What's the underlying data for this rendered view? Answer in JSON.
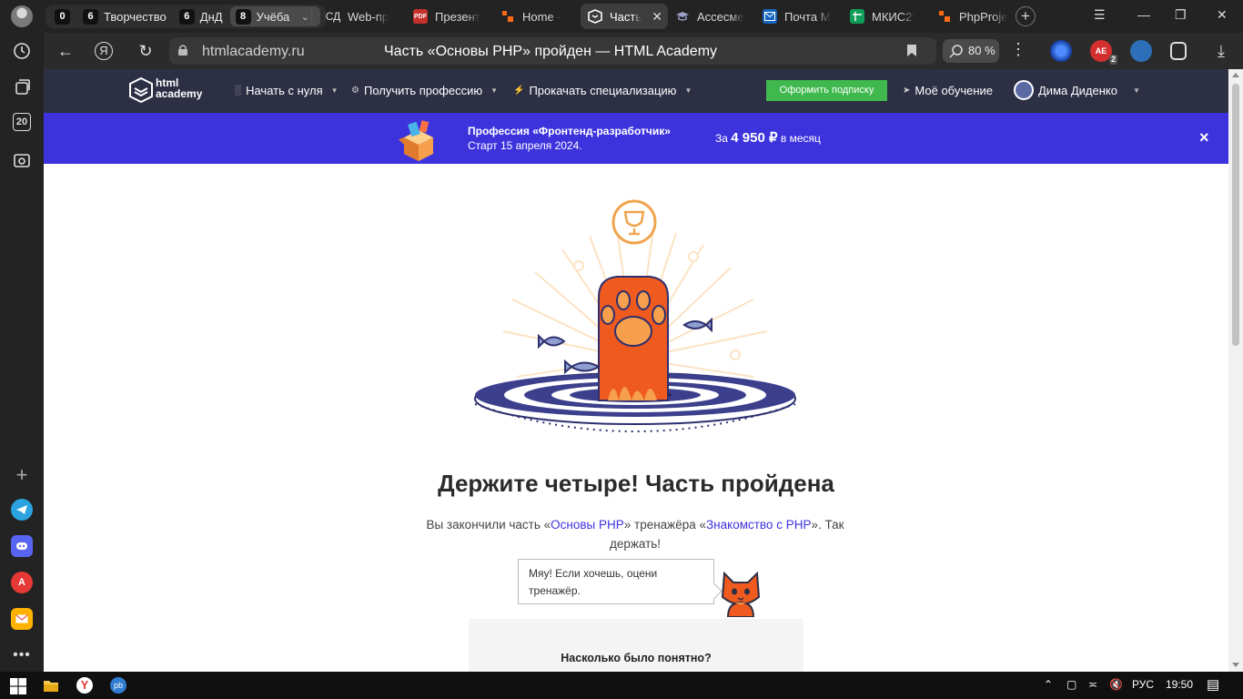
{
  "browser": {
    "tab_groups": [
      {
        "count": "0",
        "label": ""
      },
      {
        "count": "6",
        "label": "Творчество"
      },
      {
        "count": "6",
        "label": "ДнД"
      },
      {
        "count": "8",
        "label": "Учёба"
      }
    ],
    "tabs": [
      {
        "label": "Web-пр",
        "icon": "СД"
      },
      {
        "label": "Презент",
        "icon": "PDF"
      },
      {
        "label": "Home -",
        "icon": "trello-icon"
      },
      {
        "label": "Часть",
        "icon": "htmlacademy-icon",
        "active": true
      },
      {
        "label": "Ассесме",
        "icon": "cap-icon"
      },
      {
        "label": "Почта М",
        "icon": "mail-icon"
      },
      {
        "label": "МКИС2'",
        "icon": "sheets-icon"
      },
      {
        "label": "PhpProje",
        "icon": "trello-icon"
      }
    ],
    "sidebar_counter": "20",
    "address": {
      "domain": "htmlacademy.ru",
      "title": "Часть «Основы PHP» пройден — HTML Academy",
      "zoom": "80 %"
    },
    "extensions": [
      {
        "name": "vpn-icon"
      },
      {
        "name": "adblock-icon",
        "badge": "2"
      },
      {
        "name": "translate-icon"
      },
      {
        "name": "collections-icon"
      },
      {
        "name": "download-icon"
      }
    ]
  },
  "site": {
    "logo": [
      "html",
      "academy"
    ],
    "menu": [
      {
        "label": "Начать с нуля"
      },
      {
        "label": "Получить профессию"
      },
      {
        "label": "Прокачать специализацию"
      }
    ],
    "subscribe_label": "Оформить подписку",
    "my_learning": "Моё обучение",
    "user_name": "Дима Диденко"
  },
  "promo": {
    "title": "Профессия «Фронтенд-разработчик»",
    "subtitle": "Старт 15 апреля 2024.",
    "price_prefix": "За",
    "price_value": "4 950 ₽",
    "price_suffix": "в месяц",
    "close": "×"
  },
  "content": {
    "heading": "Держите четыре! Часть пройдена",
    "desc_1": "Вы закончили часть «",
    "desc_link_1": "Основы PHP",
    "desc_2": "» тренажёра «",
    "desc_link_2": "Знакомство с PHP",
    "desc_3": "». Так держать!",
    "bubble": "Мяу! Если хочешь, оцени тренажёр.",
    "rating_question": "Насколько было понятно?"
  },
  "taskbar": {
    "lang": "РУС",
    "time": "19:50"
  },
  "colors": {
    "header_bg": "#2d2f45",
    "promo_bg": "#3d33dd",
    "subscribe_green": "#3fb84d",
    "link": "#3d33dd"
  }
}
